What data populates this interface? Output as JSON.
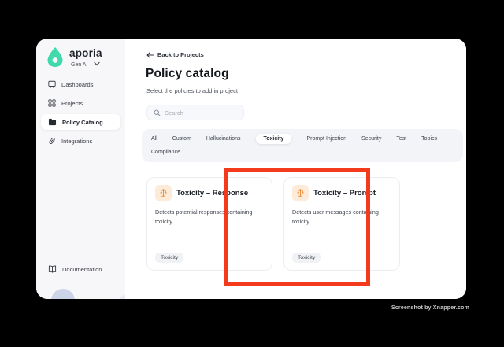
{
  "sidebar": {
    "brand": {
      "name": "aporia",
      "workspace": "Gen AI"
    },
    "items": [
      {
        "label": "Dashboards",
        "active": false
      },
      {
        "label": "Projects",
        "active": false
      },
      {
        "label": "Policy Catalog",
        "active": true
      },
      {
        "label": "Integrations",
        "active": false
      }
    ],
    "footer_item": {
      "label": "Documentation"
    }
  },
  "main": {
    "back_link": "Back to Projects",
    "title": "Policy catalog",
    "subtitle": "Select the policies to add in project",
    "search": {
      "placeholder": "Search"
    },
    "tabs": [
      {
        "label": "All",
        "active": false
      },
      {
        "label": "Custom",
        "active": false
      },
      {
        "label": "Hallucinations",
        "active": false
      },
      {
        "label": "Toxicity",
        "active": true
      },
      {
        "label": "Prompt Injection",
        "active": false
      },
      {
        "label": "Security",
        "active": false
      },
      {
        "label": "Test",
        "active": false
      },
      {
        "label": "Topics",
        "active": false
      },
      {
        "label": "Compliance",
        "active": false
      }
    ],
    "cards": [
      {
        "title": "Toxicity – Response",
        "description": "Detects potential responses containing toxicity.",
        "tag": "Toxicity",
        "icon": "scale-icon",
        "highlighted": true
      },
      {
        "title": "Toxicity – Prompt",
        "description": "Detects user messages containing toxicity.",
        "tag": "Toxicity",
        "icon": "scale-icon",
        "highlighted": false
      }
    ]
  },
  "watermark": "Screenshot by Xnapper.com",
  "colors": {
    "brand_teal": "#3FD9AC",
    "highlight_red": "#F43A1C",
    "card_icon_orange": "#EE8D3C",
    "card_icon_bg": "#FCEBD9",
    "sidebar_bg": "#F7F7F9",
    "tabs_bg": "#F3F4F8",
    "background": "#000000"
  }
}
